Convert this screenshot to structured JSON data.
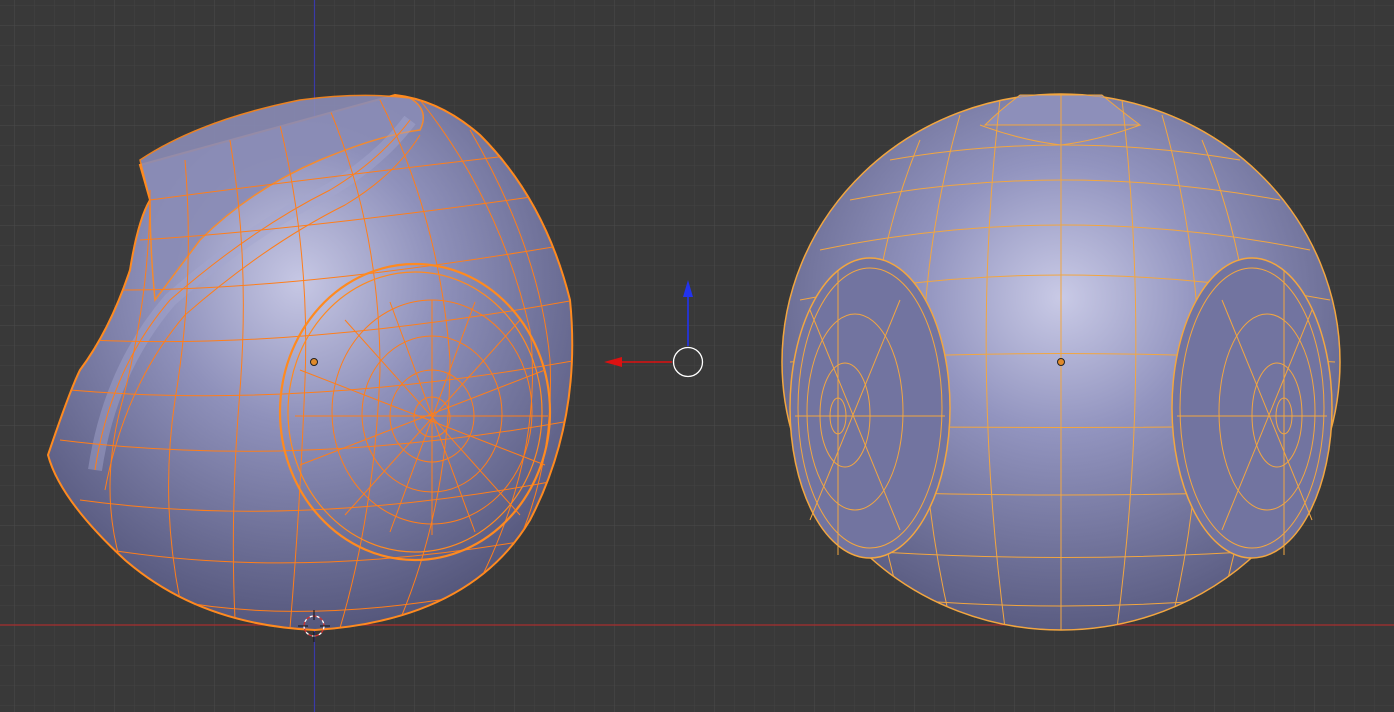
{
  "viewport": {
    "type": "3d-viewport",
    "view": "orthographic",
    "grid_visible": true
  },
  "colors": {
    "background": "#393939",
    "grid_minor": "#434343",
    "grid_major": "#4b4b4b",
    "x_axis": "#a82e2e",
    "z_axis": "#3a3aa8",
    "mesh_surface": "#7c7ea6",
    "selected_wire_active": "#ff8a1f",
    "selected_wire": "#f2a640",
    "object_origin": "#e08a2a",
    "manipulator_x": "#dd1111",
    "manipulator_z": "#2233ee",
    "manipulator_center": "#ffffff",
    "cursor_3d_ring": "#ffffff"
  },
  "objects": [
    {
      "name": "left-mesh-object",
      "view": "side",
      "selected": true,
      "active": true
    },
    {
      "name": "right-mesh-object",
      "view": "front",
      "selected": true,
      "active": false
    }
  ],
  "widgets": {
    "transform_manipulator": {
      "axes": [
        "x",
        "z"
      ]
    },
    "cursor_3d": {
      "visible": true
    }
  }
}
